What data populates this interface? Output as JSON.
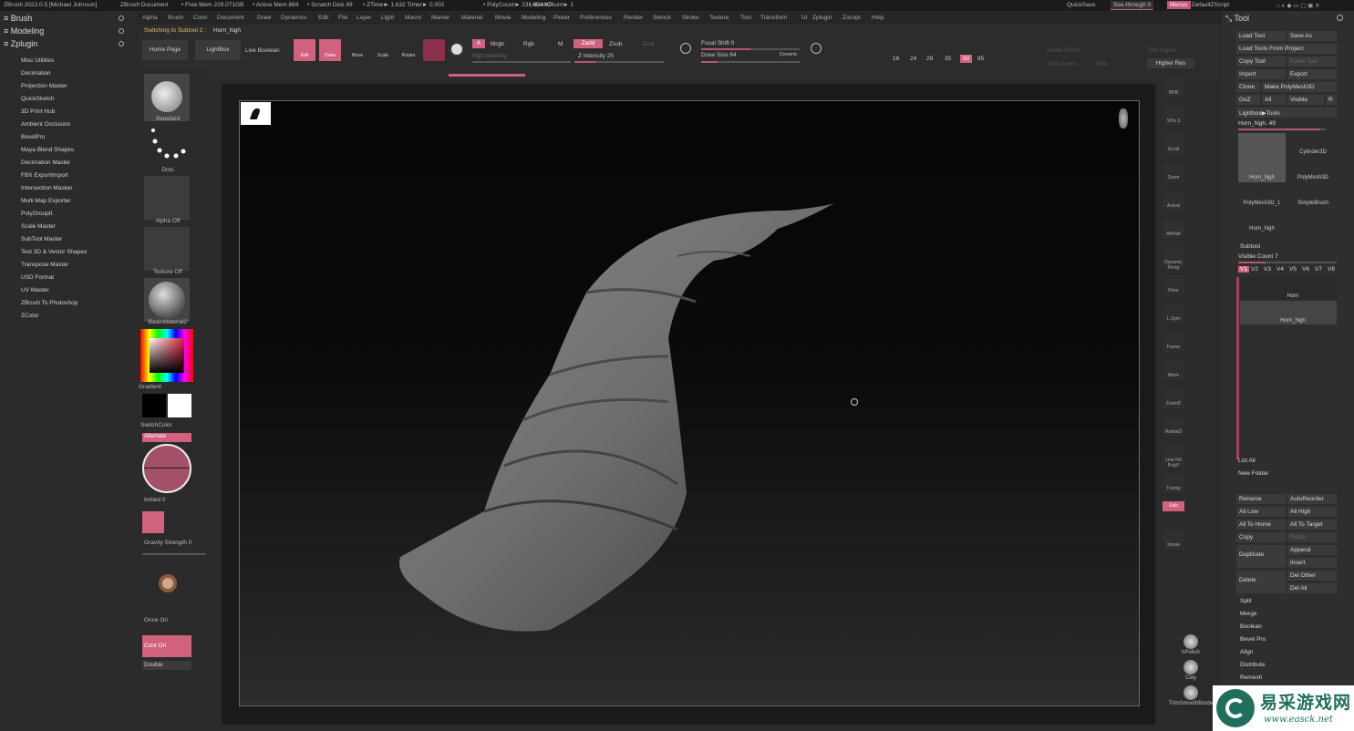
{
  "titlebar": {
    "app": "ZBrush 2022.0.5 [Michael Johnson]",
    "doc": "ZBrush Document",
    "free_mem": "• Free Mem 229.071GB",
    "active_mem": "• Active Mem 884",
    "scratch": "• Scratch Disk 49",
    "ztime": "• ZTime► 1.632 Timer► 0.002",
    "polycount": "• PolyCount► 231.424 KP",
    "meshcount": "• MeshCount► 1",
    "quicksave": "QuickSave",
    "seethrough": "See-through  0",
    "menus_btn": "Menus",
    "default_script": "DefaultZScript"
  },
  "menubar": [
    "Alpha",
    "Brush",
    "Color",
    "Document",
    "Draw",
    "Dynamics",
    "Edit",
    "File",
    "Layer",
    "Light",
    "Macro",
    "Marker",
    "Material",
    "Movie",
    "Modeling",
    "Picker",
    "Preferences",
    "Render",
    "Stencil",
    "Stroke",
    "Texture",
    "Tool",
    "Transform",
    "UI",
    "Zplugin",
    "Zscript",
    "Help"
  ],
  "left_panel": {
    "brush": "Brush",
    "modeling": "Modeling",
    "zplugin": "Zplugin",
    "items": [
      "Misc Utilities",
      "Decimation",
      "Projection Master",
      "QuickSketch",
      "3D Print Hub",
      "Ambient Occlusion",
      "BevelPro",
      "Maya Blend Shapes",
      "Decimation Master",
      "FBX ExportImport",
      "Intersection Masker",
      "Multi Map Exporter",
      "PolyGroupIt",
      "Scale Master",
      "SubTool Master",
      "Text 3D & Vector Shapes",
      "Transpose Master",
      "USD Format",
      "UV Master",
      "ZBrush To Photoshop",
      "ZColor"
    ]
  },
  "toolbar": {
    "status": "Switching to Subtool 2 :",
    "status_name": "Horn_high",
    "home_page": "Home Page",
    "lightbox": "LightBox",
    "live_boolean": "Live Boolean",
    "edit": "Edit",
    "draw": "Draw",
    "move": "Move",
    "scale": "Scale",
    "rotate": "Rotate",
    "a": "A",
    "mrgb": "Mrgb",
    "rgb": "Rgb",
    "m": "M",
    "rgb_intensity": "Rgb Intensity",
    "zadd": "Zadd",
    "zsub": "Zsub",
    "zcut": "Zcut",
    "z_intensity": "Z Intensity 25",
    "focal_shift": "Focal Shift 0",
    "draw_size": "Draw Size 64",
    "dynamic": "Dynamic",
    "numbers": [
      "18",
      "24",
      "28",
      "35",
      "50",
      "85"
    ],
    "active_number": "50",
    "active_points": "Active Points",
    "total_points": "Total Points",
    "sdiv": "SDiv",
    "del_higher": "Del Higher",
    "higher_res": "Higher Res"
  },
  "left_shelf": {
    "standard": "Standard",
    "dots": "Dots",
    "alpha_off": "Alpha Off",
    "texture_off": "Texture Off",
    "material": "BasicMaterial2",
    "gradient": "Gradient",
    "switchcolor": "SwitchColor",
    "alternate": "Alternate",
    "imbed": "Imbed 0",
    "gravity": "Gravity Strength 0",
    "once_ori": "Once Ori",
    "cont_ori": "Cont Ori",
    "double": "Double"
  },
  "right_shelf": [
    "BPR",
    "SPix 3",
    "Scroll",
    "Zoom",
    "Actual",
    "AAHalf",
    "Dynamic Persp",
    "Floor",
    "L.Sym",
    "Frame",
    "Move",
    "ZoomD",
    "RotateD",
    "Line Fill PolyF",
    "Transp",
    "Solo",
    "Xpose"
  ],
  "right_shelf_active": "Solo",
  "side_brushes": [
    "hPolish",
    "Clay",
    "TrimSmoothBorder"
  ],
  "tool_panel": {
    "title": "Tool",
    "load_tool": "Load Tool",
    "save_as": "Save As",
    "load_from_project": "Load Tools From Project",
    "copy_tool": "Copy Tool",
    "paste_tool": "Paste Tool",
    "import": "Import",
    "export": "Export",
    "clone": "Clone",
    "make_polymesh": "Make PolyMesh3D",
    "goz": "GoZ",
    "all": "All",
    "visible": "Visible",
    "r": "R",
    "lightbox_tools": "Lightbox▶Tools",
    "horn_high_slider": "Horn_high. 49",
    "tiles": [
      "Horn_high",
      "Cylinder3D",
      "PolyMesh3D",
      "PolyMesh3D_1",
      "SimpleBrush",
      "Horn_high"
    ],
    "subtool": "Subtool",
    "visible_count": "Visible Count 7",
    "views": [
      "V1",
      "V2",
      "V3",
      "V4",
      "V5",
      "V6",
      "V7",
      "V8"
    ],
    "subtools": [
      "Horn",
      "Horn_high"
    ],
    "list_all": "List All",
    "new_folder": "New Folder",
    "rename": "Rename",
    "autoreorder": "AutoReorder",
    "all_low": "All Low",
    "all_high": "All High",
    "all_to_home": "All To Home",
    "all_to_target": "All To Target",
    "copy": "Copy",
    "paste": "Paste",
    "duplicate": "Duplicate",
    "append": "Append",
    "insert": "Insert",
    "delete": "Delete",
    "del_other": "Del Other",
    "del_all": "Del All",
    "split": "Split",
    "merge": "Merge",
    "boolean": "Boolean",
    "bevel_pro": "Bevel Pro",
    "align": "Align",
    "distribute": "Distribute",
    "remesh": "Remesh"
  },
  "watermark": {
    "cn": "易采游戏网",
    "url": "www.easck.net"
  },
  "colors": {
    "accent_pink": "#d0627e",
    "panel_bg": "#2b2b2b"
  }
}
